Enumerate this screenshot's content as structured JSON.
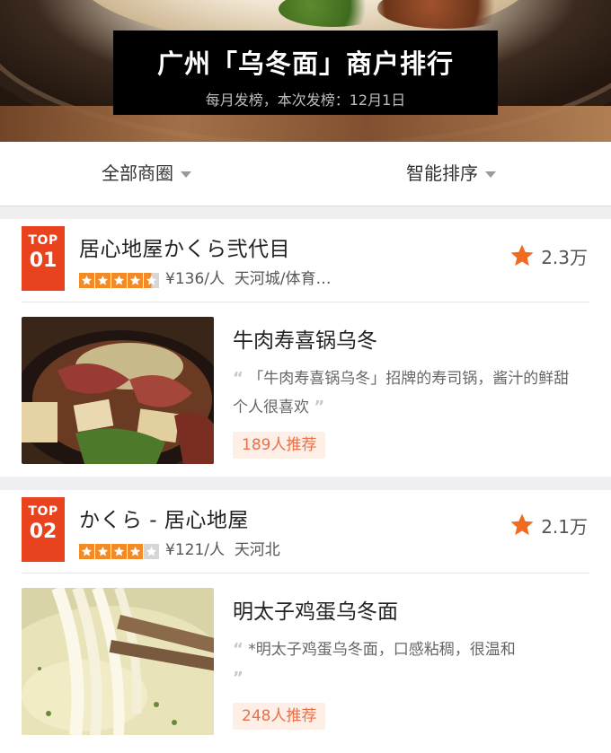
{
  "header": {
    "title": "广州「乌冬面」商户排行",
    "subtitle": "每月发榜，本次发榜：12月1日"
  },
  "filters": {
    "area": "全部商圈",
    "sort": "智能排序"
  },
  "shops": [
    {
      "badge_top": "TOP",
      "badge_num": "01",
      "name": "居心地屋かくら弐代目",
      "rating": 4.5,
      "price": "¥136/人",
      "area": "天河城/体育…",
      "favorites": "2.3万",
      "dish": "牛肉寿喜锅乌冬",
      "quote": "「牛肉寿喜锅乌冬」招牌的寿司锅，酱汁的鲜甜个人很喜欢",
      "recommend": "189人推荐"
    },
    {
      "badge_top": "TOP",
      "badge_num": "02",
      "name": "かくら - 居心地屋",
      "rating": 4,
      "price": "¥121/人",
      "area": "天河北",
      "favorites": "2.1万",
      "dish": "明太子鸡蛋乌冬面",
      "quote": "*明太子鸡蛋乌冬面，口感粘稠，很温和",
      "recommend": "248人推荐"
    }
  ],
  "colors": {
    "accent": "#e8421f",
    "star": "#f28a28",
    "recommend_bg": "#fdeee6",
    "recommend_text": "#e8704a"
  }
}
